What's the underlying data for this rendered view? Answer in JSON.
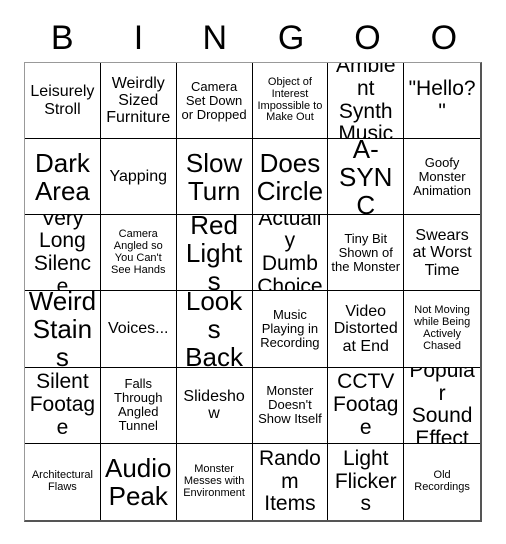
{
  "card": {
    "header_letters": [
      "B",
      "I",
      "N",
      "G",
      "O",
      "O"
    ],
    "columns": 6,
    "rows": 6,
    "text_color": "#000000",
    "background_color": "#ffffff",
    "border_color": "#000000",
    "cells": [
      {
        "text": "Leisurely Stroll",
        "size": "fs-md"
      },
      {
        "text": "Weirdly Sized Furniture",
        "size": "fs-md"
      },
      {
        "text": "Camera Set Down or Dropped",
        "size": "fs-sm"
      },
      {
        "text": "Object of Interest Impossible to Make Out",
        "size": "fs-xs"
      },
      {
        "text": "Ambient Synth Music",
        "size": "fs-lg"
      },
      {
        "text": "\"Hello?\"",
        "size": "fs-lg"
      },
      {
        "text": "Dark Area",
        "size": "fs-xl"
      },
      {
        "text": "Yapping",
        "size": "fs-md"
      },
      {
        "text": "Slow Turn",
        "size": "fs-xl"
      },
      {
        "text": "Does Circle",
        "size": "fs-xl"
      },
      {
        "text": "A-SYNC",
        "size": "fs-xl"
      },
      {
        "text": "Goofy Monster Animation",
        "size": "fs-sm"
      },
      {
        "text": "Very Long Silence",
        "size": "fs-lg"
      },
      {
        "text": "Camera Angled so You Can't See Hands",
        "size": "fs-xs"
      },
      {
        "text": "Red Lights",
        "size": "fs-xl"
      },
      {
        "text": "Actually Dumb Choice",
        "size": "fs-lg"
      },
      {
        "text": "Tiny Bit Shown of the Monster",
        "size": "fs-sm"
      },
      {
        "text": "Swears at Worst Time",
        "size": "fs-md"
      },
      {
        "text": "Weird Stains",
        "size": "fs-xl"
      },
      {
        "text": "Voices...",
        "size": "fs-md"
      },
      {
        "text": "Looks Back",
        "size": "fs-xl"
      },
      {
        "text": "Music Playing in Recording",
        "size": "fs-sm"
      },
      {
        "text": "Video Distorted at End",
        "size": "fs-md"
      },
      {
        "text": "Not Moving while Being Actively Chased",
        "size": "fs-xs"
      },
      {
        "text": "Silent Footage",
        "size": "fs-lg"
      },
      {
        "text": "Falls Through Angled Tunnel",
        "size": "fs-sm"
      },
      {
        "text": "Slideshow",
        "size": "fs-md"
      },
      {
        "text": "Monster Doesn't Show Itself",
        "size": "fs-sm"
      },
      {
        "text": "CCTV Footage",
        "size": "fs-lg"
      },
      {
        "text": "Popular Sound Effect",
        "size": "fs-lg"
      },
      {
        "text": "Architectural Flaws",
        "size": "fs-xs"
      },
      {
        "text": "Audio Peak",
        "size": "fs-xl"
      },
      {
        "text": "Monster Messes with Environment",
        "size": "fs-xs"
      },
      {
        "text": "Random Items",
        "size": "fs-lg"
      },
      {
        "text": "Light Flickers",
        "size": "fs-lg"
      },
      {
        "text": "Old Recordings",
        "size": "fs-xs"
      }
    ]
  }
}
